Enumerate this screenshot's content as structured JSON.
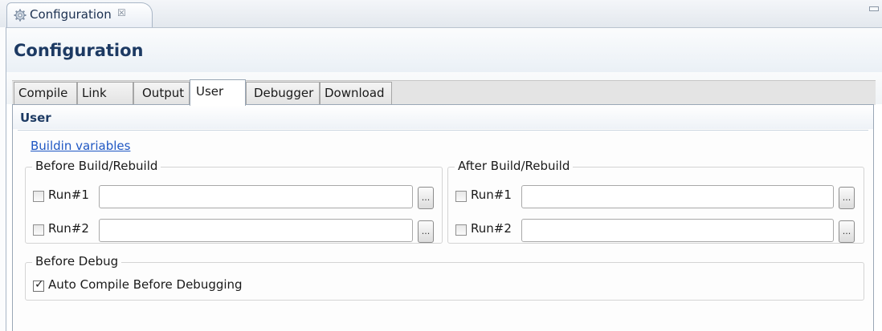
{
  "view_tab": {
    "title": "Configuration",
    "close_glyph": "☒",
    "icon": "gear-icon"
  },
  "page": {
    "title": "Configuration"
  },
  "tabs": [
    {
      "label": "Compile",
      "active": false
    },
    {
      "label": "Link",
      "active": false
    },
    {
      "label": "Output",
      "active": false
    },
    {
      "label": "User",
      "active": true
    },
    {
      "label": "Debugger",
      "active": false
    },
    {
      "label": "Download",
      "active": false
    }
  ],
  "section": {
    "title": "User",
    "link": "Buildin variables",
    "before_build": {
      "legend": "Before Build/Rebuild",
      "rows": [
        {
          "label": "Run#1",
          "checked": false,
          "value": "",
          "browse": "..."
        },
        {
          "label": "Run#2",
          "checked": false,
          "value": "",
          "browse": "..."
        }
      ]
    },
    "after_build": {
      "legend": "After Build/Rebuild",
      "rows": [
        {
          "label": "Run#1",
          "checked": false,
          "value": "",
          "browse": "..."
        },
        {
          "label": "Run#2",
          "checked": false,
          "value": "",
          "browse": "..."
        }
      ]
    },
    "before_debug": {
      "legend": "Before Debug",
      "option": {
        "label": "Auto Compile Before Debugging",
        "checked": true
      }
    }
  }
}
